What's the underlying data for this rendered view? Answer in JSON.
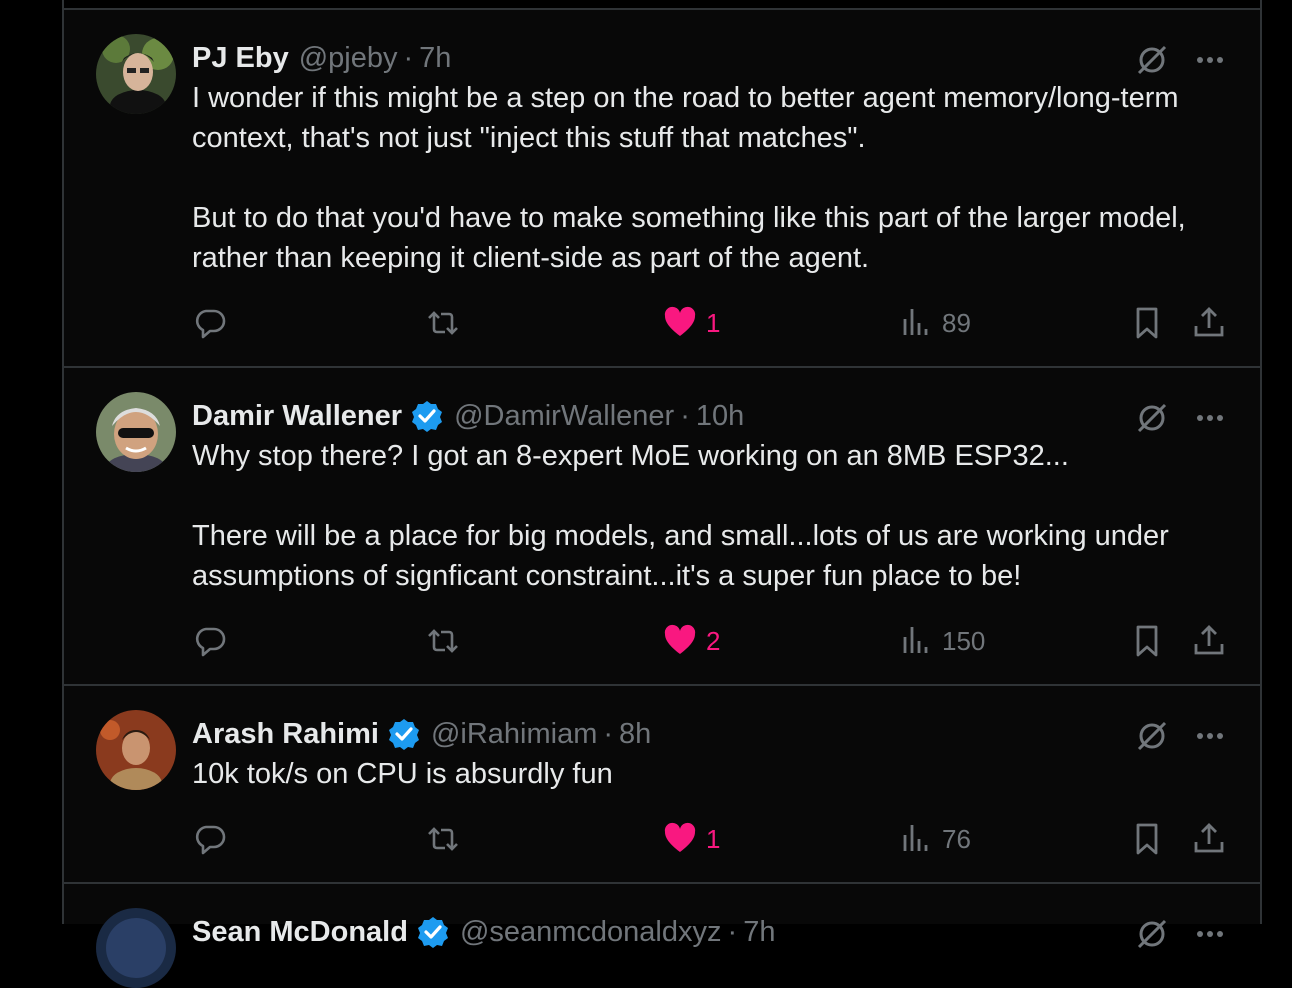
{
  "tweets": [
    {
      "name": "PJ Eby",
      "handle": "@pjeby",
      "separator": "·",
      "time": "7h",
      "verified": false,
      "text": "I wonder if this might be a step on the road to better agent memory/long-term context, that's not just \"inject this stuff that matches\".\n\nBut to do that you'd have to make something like this part of the larger model, rather than keeping it client-side as part of the agent.",
      "likes": "1",
      "views": "89"
    },
    {
      "name": "Damir Wallener",
      "handle": "@DamirWallener",
      "separator": "·",
      "time": "10h",
      "verified": true,
      "text": "Why stop there? I got an 8-expert MoE working on an 8MB ESP32...\n\nThere will be a place for big models, and small...lots of us are working under assumptions of signficant constraint...it's a super fun place to be!",
      "likes": "2",
      "views": "150"
    },
    {
      "name": "Arash Rahimi",
      "handle": "@iRahimiam",
      "separator": "·",
      "time": "8h",
      "verified": true,
      "text": "10k tok/s on CPU is absurdly fun",
      "likes": "1",
      "views": "76"
    },
    {
      "name": "Sean McDonald",
      "handle": "@seanmcdonaldxyz",
      "separator": "·",
      "time": "7h",
      "verified": true
    }
  ],
  "colors": {
    "background": "#000000",
    "border": "#2f3336",
    "text": "#e7e9ea",
    "muted": "#71767b",
    "like": "#f91880",
    "verified": "#1d9bf0"
  },
  "icons": {
    "reply": "reply-icon",
    "retweet": "retweet-icon",
    "like": "heart-icon",
    "views": "views-icon",
    "bookmark": "bookmark-icon",
    "share": "share-icon",
    "grok": "grok-icon",
    "more": "more-icon"
  }
}
